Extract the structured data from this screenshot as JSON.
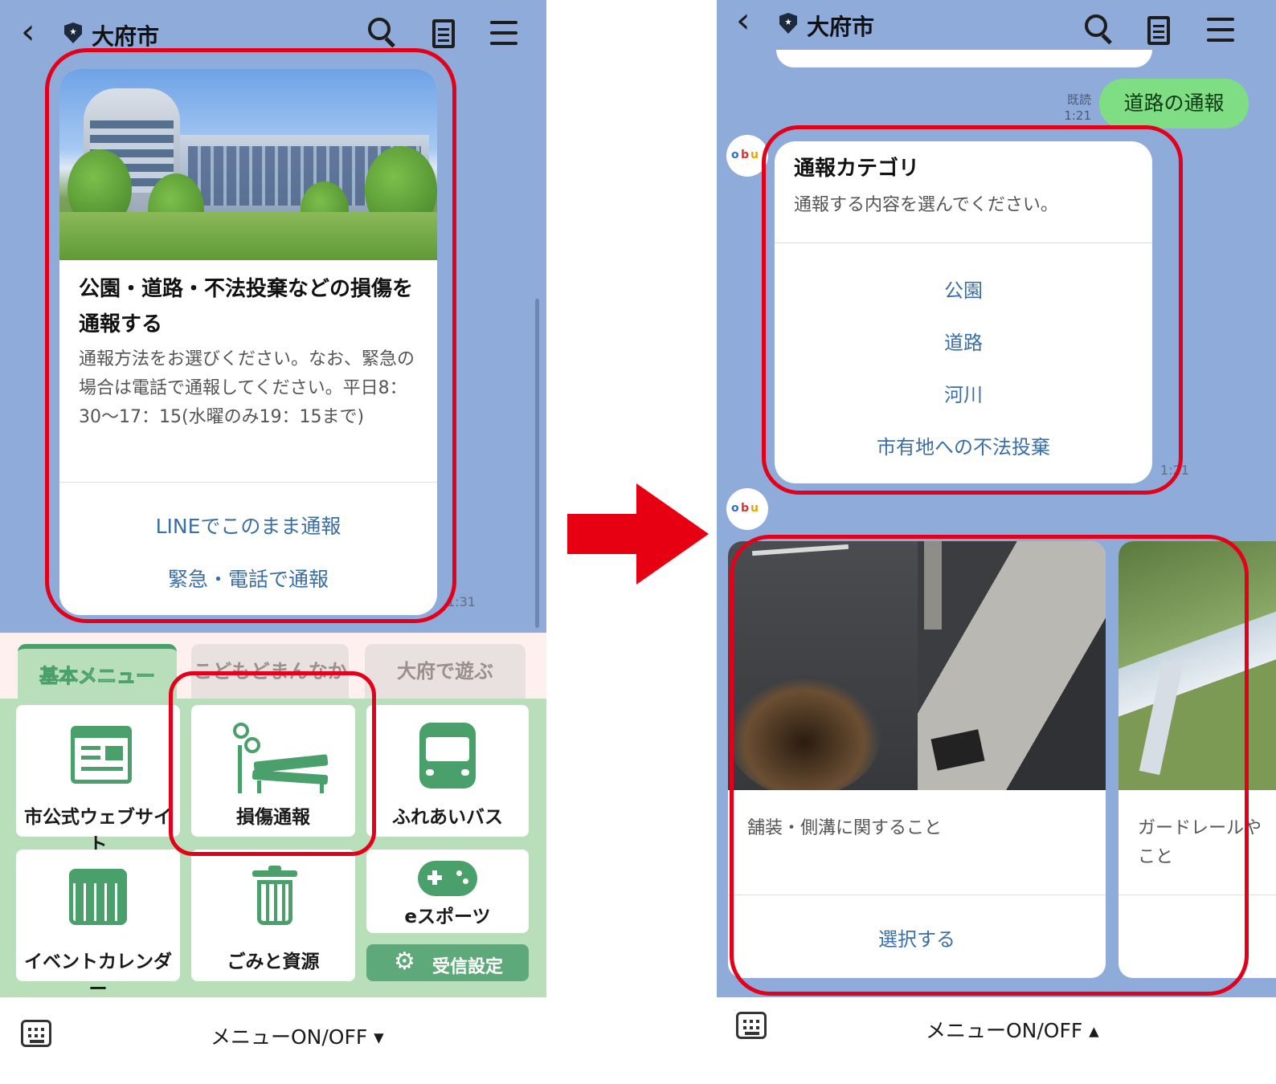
{
  "left": {
    "header": {
      "title": "大府市"
    },
    "card": {
      "title": "公園・道路・不法投棄などの損傷を通報する",
      "body": "通報方法をお選びください。なお、緊急の場合は電話で通報してください。平日8：30～17：15(水曜のみ19：15まで)",
      "actions": [
        "LINEでこのまま通報",
        "緊急・電話で通報"
      ],
      "time": "1:31"
    },
    "richmenu": {
      "tabs": [
        "基本メニュー",
        "こどもどまんなか",
        "大府で遊ぶ"
      ],
      "tiles": [
        "市公式ウェブサイト",
        "損傷通報",
        "ふれあいバス",
        "イベントカレンダー",
        "ごみと資源",
        "eスポーツ"
      ],
      "receive_settings": "受信設定"
    },
    "bottom": {
      "menu_toggle": "メニューON/OFF ▾"
    }
  },
  "right": {
    "header": {
      "title": "大府市"
    },
    "user_message": {
      "text": "道路の通報",
      "read_label": "既読",
      "time": "1:21"
    },
    "category_card": {
      "title": "通報カテゴリ",
      "subtitle": "通報する内容を選んでください。",
      "options": [
        "公園",
        "道路",
        "河川",
        "市有地への不法投棄"
      ],
      "time": "1:21"
    },
    "carousel": [
      {
        "label": "舗装・側溝に関すること",
        "action": "選択する"
      },
      {
        "label": "ガードレールや\nこと"
      }
    ],
    "avatar_text": "obu",
    "bottom": {
      "menu_toggle": "メニューON/OFF ▴"
    }
  },
  "colors": {
    "chat_background": "#8fabd9",
    "link_blue": "#3a6ea7",
    "highlight_red": "#e3001b",
    "menu_green": "#4aa06b",
    "user_bubble": "#7fde84",
    "arrow_red": "#e60012"
  }
}
